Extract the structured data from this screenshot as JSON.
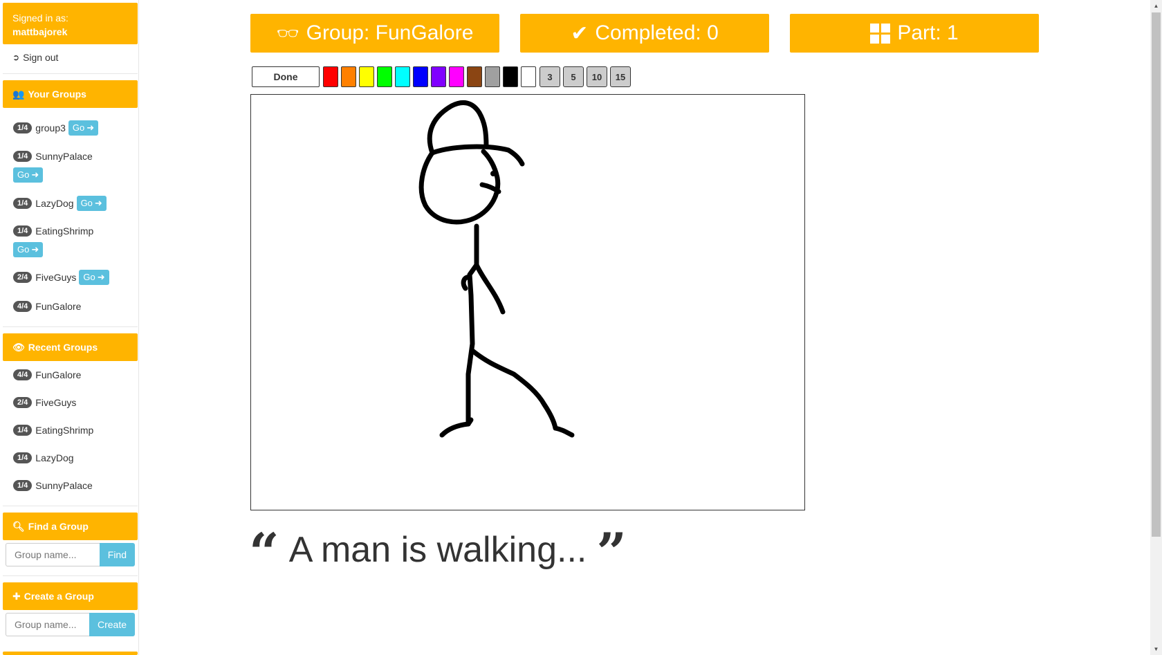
{
  "sidebar": {
    "signed_in_label": "Signed in as:",
    "username": "mattbajorek",
    "sign_out": "Sign out",
    "your_groups_header": "Your Groups",
    "your_groups": [
      {
        "badge": "1/4",
        "name": "group3",
        "go": "Go"
      },
      {
        "badge": "1/4",
        "name": "SunnyPalace",
        "go": "Go"
      },
      {
        "badge": "1/4",
        "name": "LazyDog",
        "go": "Go"
      },
      {
        "badge": "1/4",
        "name": "EatingShrimp",
        "go": "Go"
      },
      {
        "badge": "2/4",
        "name": "FiveGuys",
        "go": "Go"
      },
      {
        "badge": "4/4",
        "name": "FunGalore"
      }
    ],
    "recent_groups_header": "Recent Groups",
    "recent_groups": [
      {
        "badge": "4/4",
        "name": "FunGalore"
      },
      {
        "badge": "2/4",
        "name": "FiveGuys"
      },
      {
        "badge": "1/4",
        "name": "EatingShrimp"
      },
      {
        "badge": "1/4",
        "name": "LazyDog"
      },
      {
        "badge": "1/4",
        "name": "SunnyPalace"
      }
    ],
    "find_header": "Find a Group",
    "find_placeholder": "Group name...",
    "find_button": "Find",
    "create_header": "Create a Group",
    "create_placeholder": "Group name...",
    "create_button": "Create"
  },
  "stats": {
    "group": "Group: FunGalore",
    "completed": "Completed: 0",
    "part": "Part: 1"
  },
  "toolbar": {
    "done_label": "Done",
    "colors": [
      "#ff0000",
      "#ff8000",
      "#ffff00",
      "#00ff00",
      "#00ffff",
      "#0000ff",
      "#8000ff",
      "#ff00ff",
      "#8b4513",
      "#a0a0a0",
      "#000000",
      "#ffffff"
    ],
    "sizes": [
      "3",
      "5",
      "10",
      "15"
    ]
  },
  "caption": "A man is walking..."
}
